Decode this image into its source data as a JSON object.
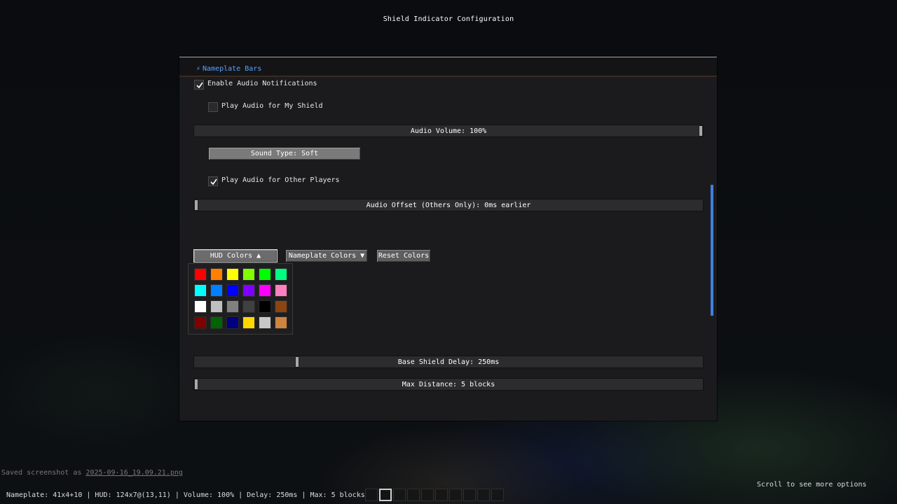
{
  "window": {
    "title": "Shield Indicator Configuration"
  },
  "section": {
    "icon": "lightning-icon",
    "label": "Nameplate Bars"
  },
  "audio": {
    "enable_label": "Enable Audio Notifications",
    "enable_checked": true,
    "my_shield_label": "Play Audio for My Shield",
    "my_shield_checked": false,
    "volume_label": "Audio Volume: 100%",
    "volume_value": 1.0,
    "sound_type_label": "Sound Type: Soft",
    "others_label": "Play Audio for Other Players",
    "others_checked": true,
    "offset_label": "Audio Offset (Others Only): 0ms earlier",
    "offset_value": 0.0
  },
  "color_tabs": {
    "hud_label": "HUD Colors ▲",
    "nameplate_label": "Nameplate Colors ▼",
    "reset_label": "Reset Colors"
  },
  "palette": {
    "colors": [
      "#ff0000",
      "#ff8000",
      "#ffff00",
      "#80ff00",
      "#00ff00",
      "#00ff80",
      "#00ffff",
      "#0080ff",
      "#0000ff",
      "#8000ff",
      "#ff00ff",
      "#ff80c0",
      "#ffffff",
      "#c0c0c0",
      "#808080",
      "#404040",
      "#000000",
      "#8b4513",
      "#800000",
      "#006400",
      "#000080",
      "#ffd700",
      "#c8c8c8",
      "#cd853f"
    ]
  },
  "delay": {
    "label": "Base Shield Delay: 250ms",
    "value": 0.2
  },
  "distance": {
    "label": "Max Distance: 5 blocks",
    "value": 0.0
  },
  "hint": {
    "scroll": "Scroll to see more options"
  },
  "chat": {
    "prefix": "Saved screenshot as ",
    "file": "2025-09-16_19.09.21.png"
  },
  "status": {
    "line": "Nameplate: 41x4+10 | HUD: 124x7@(13,11) | Volume: 100% | Delay: 250ms | Max: 5 blocks"
  },
  "hotbar": {
    "slots": 10,
    "selected": 1
  }
}
